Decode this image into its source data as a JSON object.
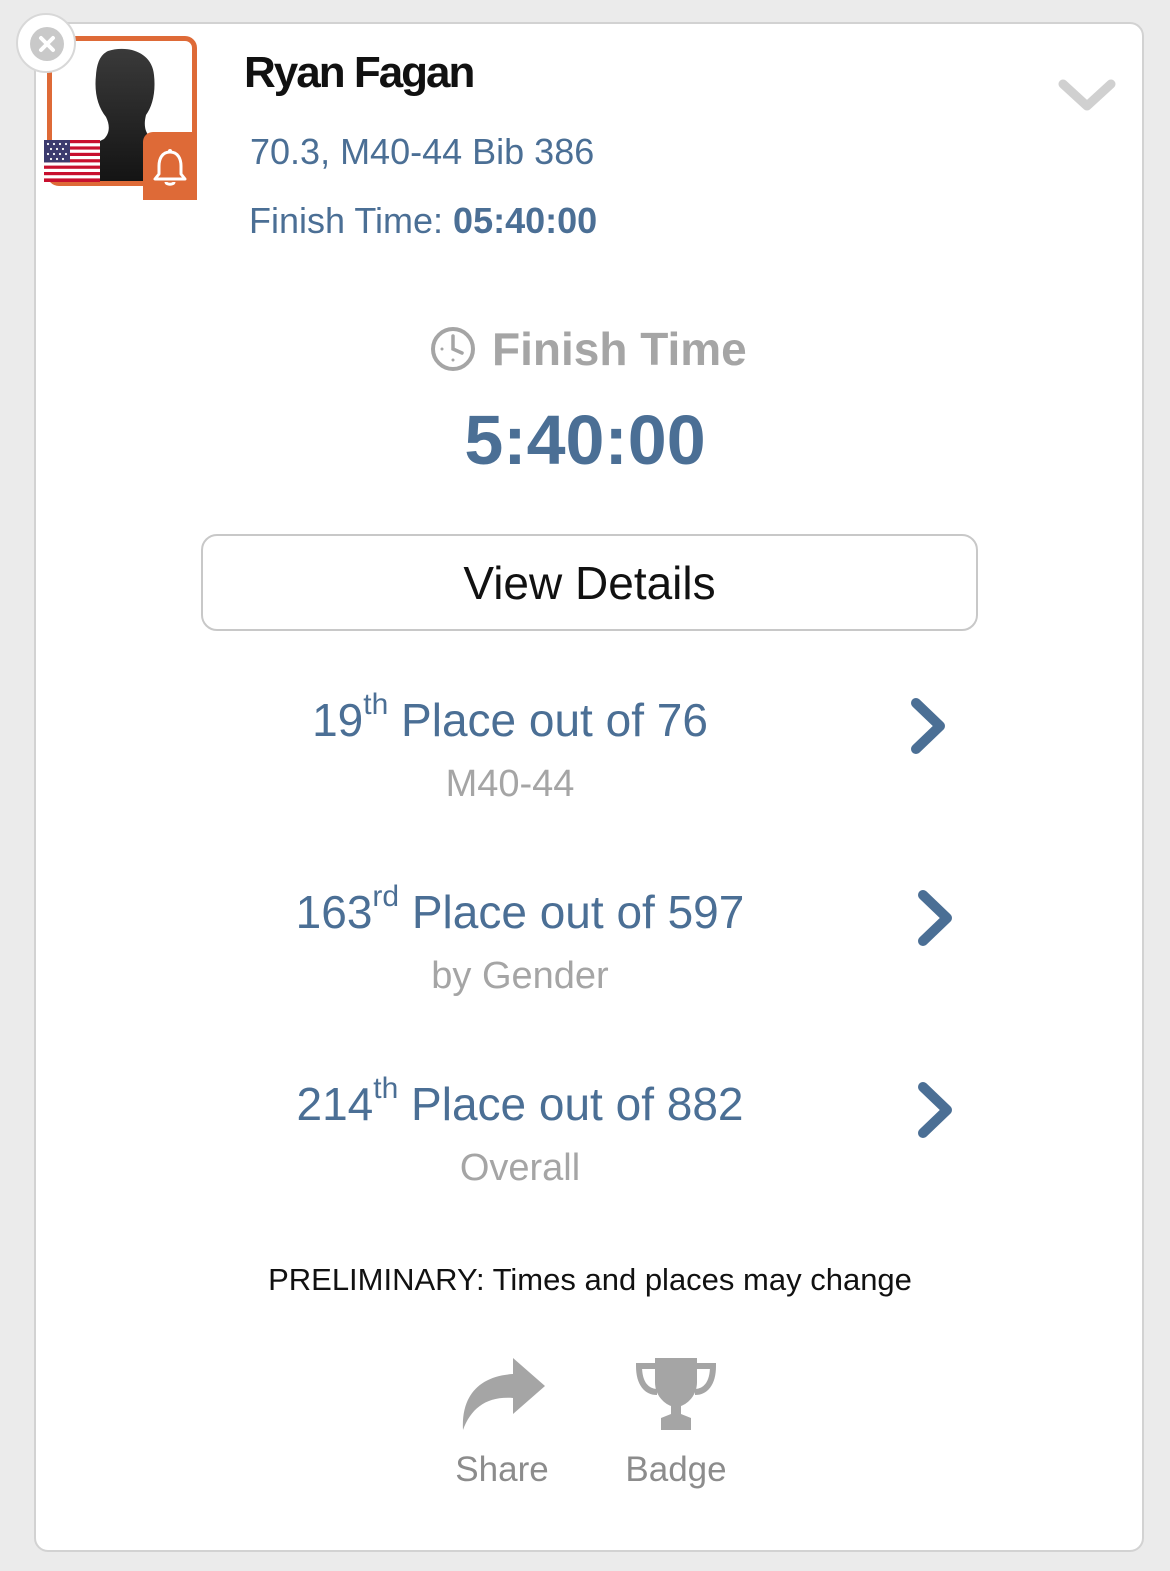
{
  "athlete": {
    "name": "Ryan Fagan",
    "meta": "70.3, M40-44 Bib 386",
    "finish_label": "Finish Time: ",
    "finish_value": "05:40:00"
  },
  "summary": {
    "heading": "Finish Time",
    "time": "5:40:00"
  },
  "details_button": "View Details",
  "placements": [
    {
      "place": "19",
      "suffix": "th",
      "text": " Place out of 76",
      "sub": "M40-44"
    },
    {
      "place": "163",
      "suffix": "rd",
      "text": " Place out of 597",
      "sub": "by Gender"
    },
    {
      "place": "214",
      "suffix": "th",
      "text": " Place out of 882",
      "sub": "Overall"
    }
  ],
  "disclaimer": "PRELIMINARY: Times and places may change",
  "actions": {
    "share": "Share",
    "badge": "Badge"
  },
  "colors": {
    "accent_orange": "#de6a37",
    "primary_blue": "#4b6f95",
    "muted_gray": "#a5a5a5"
  },
  "icons": [
    "close-icon",
    "avatar-silhouette",
    "us-flag-icon",
    "bell-icon",
    "chevron-down-icon",
    "clock-icon",
    "chevron-right-icon",
    "share-icon",
    "trophy-icon"
  ]
}
